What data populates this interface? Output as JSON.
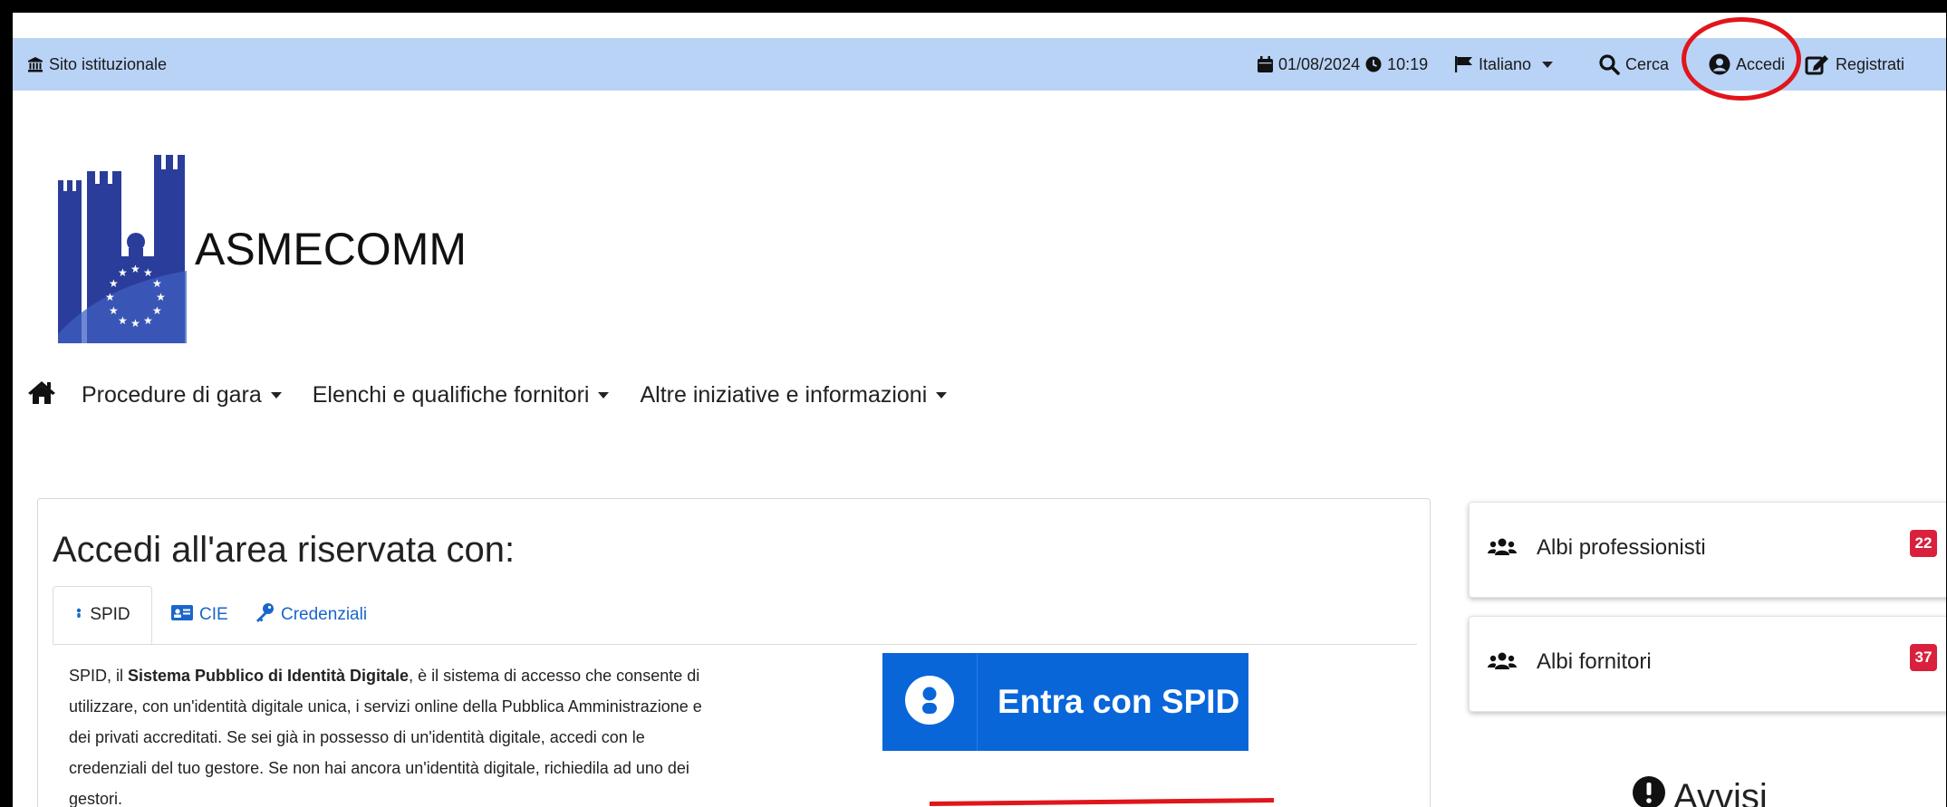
{
  "topbar": {
    "site_link": "Sito istituzionale",
    "date": "01/08/2024",
    "time": "10:19",
    "language": "Italiano",
    "search": "Cerca",
    "login": "Accedi",
    "register": "Registrati"
  },
  "brand": {
    "name": "ASMECOMM"
  },
  "nav": {
    "items": [
      {
        "label": "Procedure di gara"
      },
      {
        "label": "Elenchi e qualifiche fornitori"
      },
      {
        "label": "Altre iniziative e informazioni"
      }
    ]
  },
  "login_card": {
    "title": "Accedi all'area riservata con:",
    "tabs": [
      {
        "label": "SPID"
      },
      {
        "label": "CIE"
      },
      {
        "label": "Credenziali"
      }
    ],
    "spid_text": {
      "intro": "SPID, il ",
      "bold": "Sistema Pubblico di Identità Digitale",
      "rest": ", è il sistema di accesso che consente di utilizzare, con un'identità digitale unica, i servizi online della Pubblica Amministrazione e dei privati accreditati. Se sei già in possesso di un'identità digitale, accedi con le credenziali del tuo gestore. Se non hai ancora un'identità digitale, richiedila ad uno dei gestori."
    },
    "spid_button": "Entra con SPID"
  },
  "sidebar": {
    "cards": [
      {
        "label": "Albi professionisti",
        "count": "22"
      },
      {
        "label": "Albi fornitori",
        "count": "37"
      }
    ],
    "avvisi_title": "Avvisi"
  },
  "colors": {
    "topbar_bg": "#b9d3f7",
    "logo_blue": "#2a3d9a",
    "spid_blue": "#0866d9",
    "badge_red": "#d9213d",
    "annotation_red": "#e0161b"
  }
}
